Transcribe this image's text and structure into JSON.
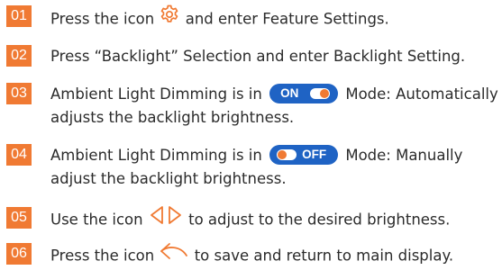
{
  "steps": [
    {
      "num": "01",
      "before": "Press the icon",
      "icon": "gear-icon",
      "after": "and enter Feature Settings."
    },
    {
      "num": "02",
      "text": "Press “Backlight” Selection and enter Backlight Setting."
    },
    {
      "num": "03",
      "before": "Ambient Light Dimming is in",
      "toggle_label": "ON",
      "after": "Mode: Automatically",
      "line2": "adjusts the backlight brightness."
    },
    {
      "num": "04",
      "before": "Ambient Light Dimming is in",
      "toggle_label": "OFF",
      "after": "Mode: Manually",
      "line2": "adjust the backlight brightness."
    },
    {
      "num": "05",
      "before": "Use the icon",
      "icon": "left-right-arrows-icon",
      "after": "to adjust to the desired brightness."
    },
    {
      "num": "06",
      "before": "Press the icon",
      "icon": "return-arrow-icon",
      "after": "to save and return to main display."
    }
  ],
  "colors": {
    "accent": "#f07a33",
    "toggle_blue": "#1f63c4",
    "text": "#2b2b2b"
  }
}
